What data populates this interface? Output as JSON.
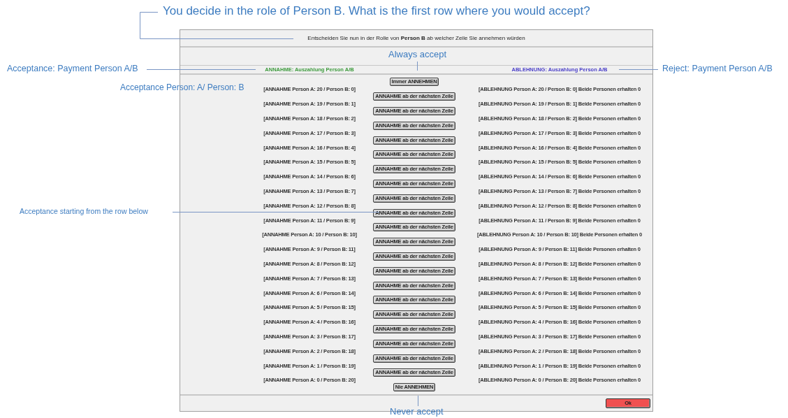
{
  "window": {
    "instruction": "Entscheiden Sie nun in der Rolle von **Person B** ab welcher Zeile Sie annehmen würden",
    "accept_header": "ANNAHME: Auszahlung Person A/B",
    "reject_header": "ABLEHNUNG: Auszahlung Person A/B",
    "rows": [
      {
        "accept": "[ANNAHME Person A: 20 / Person B: 0]",
        "reject": "[ABLEHNUNG Person A: 20 / Person B: 0] Beide Personen erhalten 0"
      },
      {
        "accept": "[ANNAHME Person A: 19 / Person B: 1]",
        "reject": "[ABLEHNUNG Person A: 19 / Person B: 1] Beide Personen erhalten 0"
      },
      {
        "accept": "[ANNAHME Person A: 18 / Person B: 2]",
        "reject": "[ABLEHNUNG Person A: 18 / Person B: 2] Beide Personen erhalten 0"
      },
      {
        "accept": "[ANNAHME Person A: 17 / Person B: 3]",
        "reject": "[ABLEHNUNG Person A: 17 / Person B: 3] Beide Personen erhalten 0"
      },
      {
        "accept": "[ANNAHME Person A: 16 / Person B: 4]",
        "reject": "[ABLEHNUNG Person A: 16 / Person B: 4] Beide Personen erhalten 0"
      },
      {
        "accept": "[ANNAHME Person A: 15 / Person B: 5]",
        "reject": "[ABLEHNUNG Person A: 15 / Person B: 5] Beide Personen erhalten 0"
      },
      {
        "accept": "[ANNAHME Person A: 14 / Person B: 6]",
        "reject": "[ABLEHNUNG Person A: 14 / Person B: 6] Beide Personen erhalten 0"
      },
      {
        "accept": "[ANNAHME Person A: 13 / Person B: 7]",
        "reject": "[ABLEHNUNG Person A: 13 / Person B: 7] Beide Personen erhalten 0"
      },
      {
        "accept": "[ANNAHME Person A: 12 / Person B: 8]",
        "reject": "[ABLEHNUNG Person A: 12 / Person B: 8] Beide Personen erhalten 0"
      },
      {
        "accept": "[ANNAHME Person A: 11 / Person B: 9]",
        "reject": "[ABLEHNUNG Person A: 11 / Person B: 9] Beide Personen erhalten 0"
      },
      {
        "accept": "[ANNAHME Person A: 10 / Person B: 10]",
        "reject": "[ABLEHNUNG Person A: 10 / Person B: 10] Beide Personen erhalten 0"
      },
      {
        "accept": "[ANNAHME Person A: 9 / Person B: 11]",
        "reject": "[ABLEHNUNG Person A: 9 / Person B: 11] Beide Personen erhalten 0"
      },
      {
        "accept": "[ANNAHME Person A: 8 / Person B: 12]",
        "reject": "[ABLEHNUNG Person A: 8 / Person B: 12] Beide Personen erhalten 0"
      },
      {
        "accept": "[ANNAHME Person A: 7 / Person B: 13]",
        "reject": "[ABLEHNUNG Person A: 7 / Person B: 13] Beide Personen erhalten 0"
      },
      {
        "accept": "[ANNAHME Person A: 6 / Person B: 14]",
        "reject": "[ABLEHNUNG Person A: 6 / Person B: 14] Beide Personen erhalten 0"
      },
      {
        "accept": "[ANNAHME Person A: 5 / Person B: 15]",
        "reject": "[ABLEHNUNG Person A: 5 / Person B: 15] Beide Personen erhalten 0"
      },
      {
        "accept": "[ANNAHME Person A: 4 / Person B: 16]",
        "reject": "[ABLEHNUNG Person A: 4 / Person B: 16] Beide Personen erhalten 0"
      },
      {
        "accept": "[ANNAHME Person A: 3 / Person B: 17]",
        "reject": "[ABLEHNUNG Person A: 3 / Person B: 17] Beide Personen erhalten 0"
      },
      {
        "accept": "[ANNAHME Person A: 2 / Person B: 18]",
        "reject": "[ABLEHNUNG Person A: 2 / Person B: 18] Beide Personen erhalten 0"
      },
      {
        "accept": "[ANNAHME Person A: 1 / Person B: 19]",
        "reject": "[ABLEHNUNG Person A: 1 / Person B: 19] Beide Personen erhalten 0"
      },
      {
        "accept": "[ANNAHME Person A: 0 / Person B: 20]",
        "reject": "[ABLEHNUNG Person A: 0 / Person B: 20] Beide Personen erhalten 0"
      }
    ],
    "buttons": [
      "Immer ANNEHMEN",
      "ANNAHME ab der nächsten Zeile",
      "ANNAHME ab der nächsten Zeile",
      "ANNAHME ab der nächsten Zeile",
      "ANNAHME ab der nächsten Zeile",
      "ANNAHME ab der nächsten Zeile",
      "ANNAHME ab der nächsten Zeile",
      "ANNAHME ab der nächsten Zeile",
      "ANNAHME ab der nächsten Zeile",
      "ANNAHME ab der nächsten Zeile",
      "ANNAHME ab der nächsten Zeile",
      "ANNAHME ab der nächsten Zeile",
      "ANNAHME ab der nächsten Zeile",
      "ANNAHME ab der nächsten Zeile",
      "ANNAHME ab der nächsten Zeile",
      "ANNAHME ab der nächsten Zeile",
      "ANNAHME ab der nächsten Zeile",
      "ANNAHME ab der nächsten Zeile",
      "ANNAHME ab der nächsten Zeile",
      "ANNAHME ab der nächsten Zeile",
      "ANNAHME ab der nächsten Zeile",
      "Nie ANNEHMEN"
    ],
    "ok_button": "Ok"
  },
  "annotations": [
    {
      "text": "You decide in the role of Person B. What is the first row where you would accept?"
    },
    {
      "text": "Always accept"
    },
    {
      "text": "Acceptance: Payment Person A/B"
    },
    {
      "text": "Reject: Payment Person A/B"
    },
    {
      "text": "Acceptance Person: A/ Person: B"
    },
    {
      "text": "Acceptance starting from the row below"
    },
    {
      "text": "Never accept"
    }
  ]
}
